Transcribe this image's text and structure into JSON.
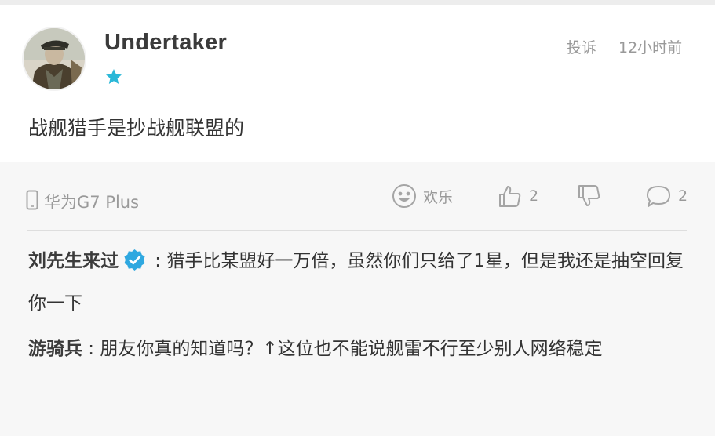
{
  "post": {
    "username": "Undertaker",
    "report_label": "投诉",
    "time": "12小时前",
    "content": "战舰猎手是抄战舰联盟的"
  },
  "meta": {
    "device": "华为G7 Plus",
    "emoji_label": "欢乐",
    "likes": "2",
    "comments": "2"
  },
  "replies": [
    {
      "user": "刘先生来过",
      "verified": true,
      "separator": " : ",
      "text": "猎手比某盟好一万倍，虽然你们只给了1星，但是我还是抽空回复你一下"
    },
    {
      "user": "游骑兵",
      "verified": false,
      "separator": " : ",
      "text": "朋友你真的知道吗？↑这位也不能说舰雷不行至少别人网络稳定"
    }
  ],
  "colors": {
    "star": "#2bb8d8",
    "verified": "#2fa8e0",
    "meta_gray": "#999999"
  }
}
